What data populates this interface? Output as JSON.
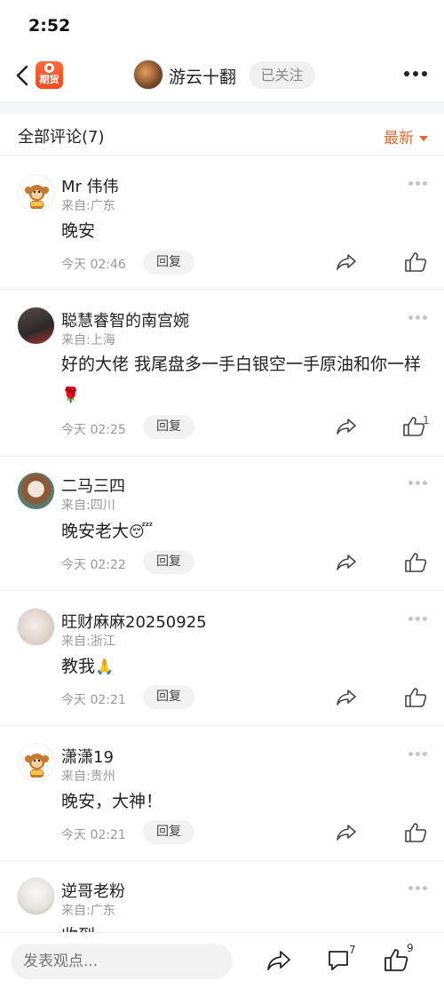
{
  "status": {
    "time": "2:52"
  },
  "nav": {
    "app_badge": "期货",
    "host_name": "游云十翻",
    "follow_label": "已关注"
  },
  "comments_header": {
    "title": "全部评论(7)",
    "sort_label": "最新"
  },
  "comments": [
    {
      "name": "Mr 伟伟",
      "location": "来自:广东",
      "text": "晚安",
      "time": "今天 02:46",
      "reply": "回复",
      "likes": ""
    },
    {
      "name": "聪慧睿智的南宫婉",
      "location": "来自:上海",
      "text": "好的大佬 我尾盘多一手白银空一手原油和你一样",
      "emoji": "🌹",
      "time": "今天 02:25",
      "reply": "回复",
      "likes": "1"
    },
    {
      "name": "二马三四",
      "location": "来自:四川",
      "text": "晚安老大",
      "emoji": "😴",
      "time": "今天 02:22",
      "reply": "回复",
      "likes": ""
    },
    {
      "name": "旺财麻麻20250925",
      "location": "来自:浙江",
      "text": "教我",
      "emoji": "🙏",
      "time": "今天 02:21",
      "reply": "回复",
      "likes": ""
    },
    {
      "name": "潇潇19",
      "location": "来自:贵州",
      "text": "晚安，大神！",
      "time": "今天 02:21",
      "reply": "回复",
      "likes": ""
    },
    {
      "name": "逆哥老粉",
      "location": "来自:广东",
      "text": "收到",
      "time": "",
      "reply": "",
      "likes": ""
    }
  ],
  "bottom_bar": {
    "input_placeholder": "发表观点...",
    "comment_count": "7",
    "like_count": "9"
  },
  "colors": {
    "accent": "#e06a2c",
    "badge": "#f24a1f"
  }
}
